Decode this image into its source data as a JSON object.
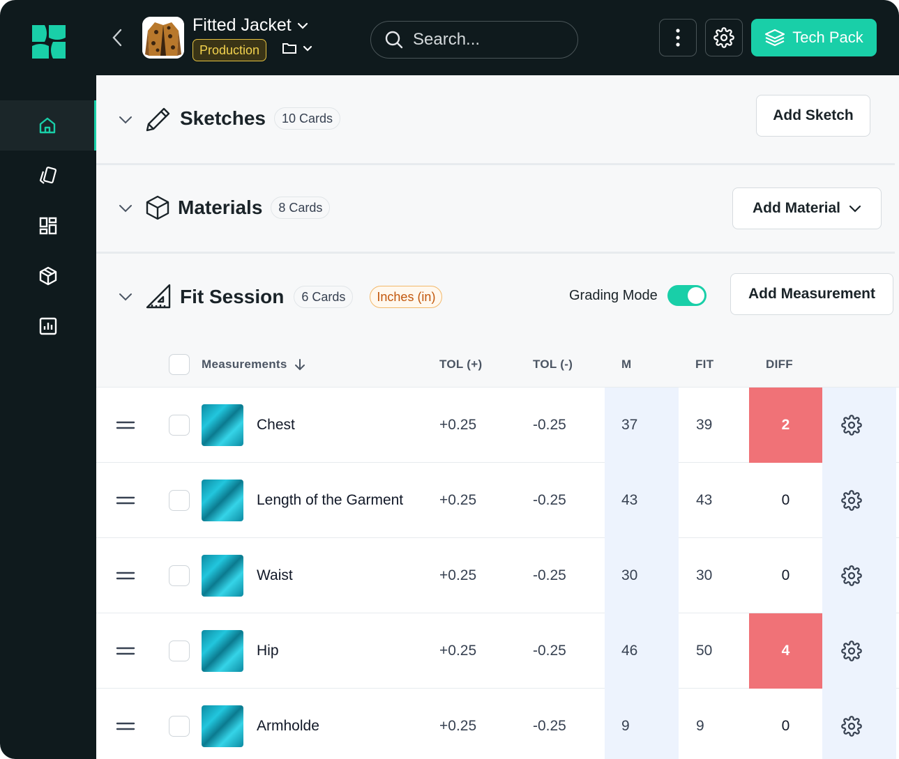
{
  "topbar": {
    "product_name": "Fitted Jacket",
    "status": "Production",
    "search_placeholder": "Search...",
    "techpack_label": "Tech Pack"
  },
  "sidebar": {
    "items": [
      {
        "icon": "home-icon",
        "active": true
      },
      {
        "icon": "cards-icon",
        "active": false
      },
      {
        "icon": "dashboard-icon",
        "active": false
      },
      {
        "icon": "box-icon",
        "active": false
      },
      {
        "icon": "chart-icon",
        "active": false
      }
    ]
  },
  "sections": {
    "sketches": {
      "title": "Sketches",
      "count": "10 Cards",
      "button": "Add Sketch"
    },
    "materials": {
      "title": "Materials",
      "count": "8 Cards",
      "button": "Add Material"
    },
    "fit_session": {
      "title": "Fit Session",
      "count": "6 Cards",
      "unit": "Inches (in)",
      "grading_label": "Grading Mode",
      "grading_on": true,
      "button": "Add Measurement"
    }
  },
  "table": {
    "headers": {
      "measurements": "Measurements",
      "tol_plus": "TOL (+)",
      "tol_minus": "TOL (-)",
      "m": "M",
      "fit": "FIT",
      "diff": "DIFF"
    },
    "rows": [
      {
        "name": "Chest",
        "tol_plus": "+0.25",
        "tol_minus": "-0.25",
        "m": "37",
        "fit": "39",
        "diff": "2",
        "alert": true
      },
      {
        "name": "Length of the Garment",
        "tol_plus": "+0.25",
        "tol_minus": "-0.25",
        "m": "43",
        "fit": "43",
        "diff": "0",
        "alert": false
      },
      {
        "name": "Waist",
        "tol_plus": "+0.25",
        "tol_minus": "-0.25",
        "m": "30",
        "fit": "30",
        "diff": "0",
        "alert": false
      },
      {
        "name": "Hip",
        "tol_plus": "+0.25",
        "tol_minus": "-0.25",
        "m": "46",
        "fit": "50",
        "diff": "4",
        "alert": true
      },
      {
        "name": "Armholde",
        "tol_plus": "+0.25",
        "tol_minus": "-0.25",
        "m": "9",
        "fit": "9",
        "diff": "0",
        "alert": false
      }
    ]
  },
  "colors": {
    "accent": "#19cfa8",
    "sidebar": "#0f1a1d",
    "alert": "#f07277",
    "highlight_col": "#edf3fd"
  }
}
